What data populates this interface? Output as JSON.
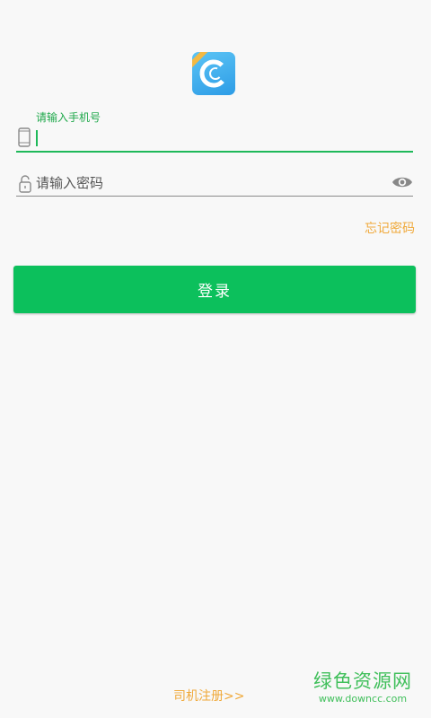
{
  "app": {
    "logo_icon": "app-logo-c-icon",
    "accent_color": "#0cc05c",
    "link_color": "#f0a93a"
  },
  "login_form": {
    "phone_hint": "请输入手机号",
    "phone_value": "",
    "phone_icon": "phone-icon",
    "password_placeholder": "请输入密码",
    "password_value": "",
    "lock_icon": "lock-icon",
    "toggle_visibility_icon": "eye-icon",
    "forgot_password_label": "忘记密码",
    "login_button_label": "登录"
  },
  "footer": {
    "driver_register_label": "司机注册>>"
  },
  "watermark": {
    "title": "绿色资源网",
    "url": "www.downcc.com"
  }
}
